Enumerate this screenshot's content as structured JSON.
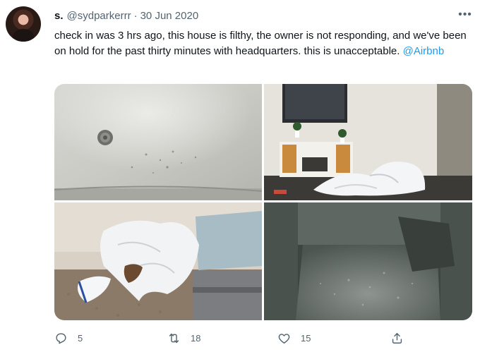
{
  "tweet": {
    "display_name": "s.",
    "handle": "@sydparkerrr",
    "separator": "·",
    "date": "30 Jun 2020",
    "more_label": "•••",
    "text_main": "check in was 3 hrs ago, this house is filthy, the owner is not responding, and we've been on hold for the past thirty minutes with headquarters. this is unacceptable. ",
    "mention": "@Airbnb",
    "media": [
      {
        "subject": "bathtub-drain"
      },
      {
        "subject": "living-room-tv-stand"
      },
      {
        "subject": "bedroom-bed-linens"
      },
      {
        "subject": "stained-sofa"
      }
    ],
    "actions": {
      "reply_count": "5",
      "retweet_count": "18",
      "like_count": "15"
    },
    "icons": {
      "reply": "reply-icon",
      "retweet": "retweet-icon",
      "like": "heart-icon",
      "share": "share-icon"
    },
    "colors": {
      "text": "#0f1419",
      "secondary": "#536471",
      "link": "#1d9bf0"
    }
  }
}
